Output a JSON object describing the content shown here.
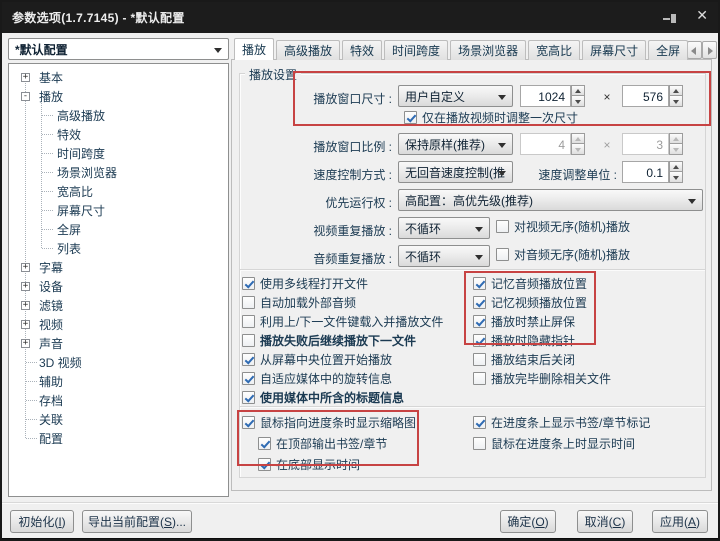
{
  "window": {
    "title": "参数选项(1.7.7145) - *默认配置",
    "close_glyph": "✕"
  },
  "profile": {
    "value": "*默认配置"
  },
  "tabs": {
    "active_index": 0,
    "items": [
      "播放",
      "高级播放",
      "特效",
      "时间跨度",
      "场景浏览器",
      "宽高比",
      "屏幕尺寸",
      "全屏"
    ]
  },
  "sidebar": {
    "expander_glyphs": {
      "collapsed": "+",
      "expanded": "-"
    },
    "items": [
      {
        "label": "基本",
        "type": "collapsed"
      },
      {
        "label": "播放",
        "type": "expanded"
      },
      {
        "label": "高级播放",
        "type": "child"
      },
      {
        "label": "特效",
        "type": "child"
      },
      {
        "label": "时间跨度",
        "type": "child"
      },
      {
        "label": "场景浏览器",
        "type": "child"
      },
      {
        "label": "宽高比",
        "type": "child"
      },
      {
        "label": "屏幕尺寸",
        "type": "child"
      },
      {
        "label": "全屏",
        "type": "child"
      },
      {
        "label": "列表",
        "type": "child"
      },
      {
        "label": "字幕",
        "type": "collapsed"
      },
      {
        "label": "设备",
        "type": "collapsed"
      },
      {
        "label": "滤镜",
        "type": "collapsed"
      },
      {
        "label": "视频",
        "type": "collapsed"
      },
      {
        "label": "声音",
        "type": "collapsed"
      },
      {
        "label": "3D 视频",
        "type": "leaf"
      },
      {
        "label": "辅助",
        "type": "leaf"
      },
      {
        "label": "存档",
        "type": "leaf"
      },
      {
        "label": "关联",
        "type": "leaf"
      },
      {
        "label": "配置",
        "type": "leaf"
      }
    ]
  },
  "panel": {
    "group_title": "播放设置",
    "rows": {
      "window_size": {
        "label": "播放窗口尺寸 :",
        "combo": "用户自定义",
        "width": "1024",
        "times": "×",
        "height": "576"
      },
      "resize_once": {
        "label": "仅在播放视频时调整一次尺寸",
        "checked": true
      },
      "window_ratio": {
        "label": "播放窗口比例 :",
        "combo": "保持原样(推荐)",
        "a": "4",
        "times": "×",
        "b": "3"
      },
      "speed": {
        "label": "速度控制方式 :",
        "combo": "无回音速度控制(推",
        "unit_label": "速度调整单位 :",
        "unit": "0.1"
      },
      "priority": {
        "label": "优先运行权 :",
        "combo": "高配置：高优先级(推荐)"
      },
      "video_repeat": {
        "label": "视频重复播放 :",
        "combo": "不循环",
        "check": {
          "label": "对视频无序(随机)播放",
          "checked": false
        }
      },
      "audio_repeat": {
        "label": "音频重复播放 :",
        "combo": "不循环",
        "check": {
          "label": "对音频无序(随机)播放",
          "checked": false
        }
      }
    },
    "checks_left": [
      {
        "label": "使用多线程打开文件",
        "checked": true
      },
      {
        "label": "自动加载外部音频",
        "checked": false
      },
      {
        "label": "利用上/下一文件键载入并播放文件",
        "checked": false
      },
      {
        "label": "播放失败后继续播放下一文件",
        "checked": false,
        "bold": true
      },
      {
        "label": "从屏幕中央位置开始播放",
        "checked": true
      },
      {
        "label": "自适应媒体中的旋转信息",
        "checked": true
      },
      {
        "label": "使用媒体中所含的标题信息",
        "checked": true,
        "bold": true
      }
    ],
    "checks_right": [
      {
        "label": "记忆音频播放位置",
        "checked": true
      },
      {
        "label": "记忆视频播放位置",
        "checked": true
      },
      {
        "label": "播放时禁止屏保",
        "checked": true
      },
      {
        "label": "播放时隐藏指针",
        "checked": true
      },
      {
        "label": "播放结束后关闭",
        "checked": false
      },
      {
        "label": "播放完毕删除相关文件",
        "checked": false
      }
    ],
    "bottom_left": [
      {
        "label": "鼠标指向进度条时显示缩略图",
        "checked": true
      },
      {
        "label": "在顶部输出书签/章节",
        "checked": true,
        "indent": true
      },
      {
        "label": "在底部显示时间",
        "checked": true,
        "indent": true
      }
    ],
    "bottom_right": [
      {
        "label": "在进度条上显示书签/章节标记",
        "checked": true
      },
      {
        "label": "鼠标在进度条上时显示时间",
        "checked": false
      }
    ]
  },
  "footer": {
    "buttons": [
      {
        "pre": "初始化(",
        "key": "I",
        "post": ")"
      },
      {
        "pre": "导出当前配置(",
        "key": "S",
        "post": ")..."
      },
      {
        "pre": "确定(",
        "key": "O",
        "post": ")"
      },
      {
        "pre": "取消(",
        "key": "C",
        "post": ")"
      },
      {
        "pre": "应用(",
        "key": "A",
        "post": ")"
      }
    ]
  },
  "colors": {
    "annotation_red": "#c74343",
    "titlebar_bg": "#1c1c1c",
    "check_blue": "#2f6bb3"
  }
}
